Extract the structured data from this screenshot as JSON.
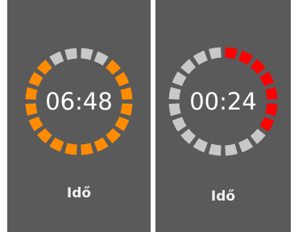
{
  "timers": [
    {
      "time": "06:48",
      "label": "Idő",
      "segments_total": 20,
      "segments_active": 16,
      "active_start_index": 2,
      "active_color": "#ff8c00",
      "inactive_color": "#c8c8c8"
    },
    {
      "time": "00:24",
      "label": "Idő",
      "segments_total": 20,
      "segments_active": 7,
      "active_start_index": 0,
      "active_color": "#ff0000",
      "inactive_color": "#c8c8c8"
    }
  ]
}
